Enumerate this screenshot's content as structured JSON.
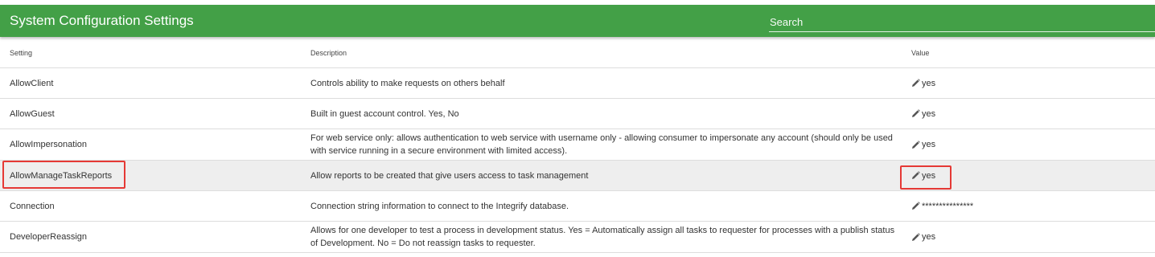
{
  "header": {
    "title": "System Configuration Settings",
    "search_placeholder": "Search"
  },
  "table": {
    "columns": {
      "setting": "Setting",
      "description": "Description",
      "value": "Value"
    },
    "rows": [
      {
        "setting": "AllowClient",
        "description": "Controls ability to make requests on others behalf",
        "value": "yes"
      },
      {
        "setting": "AllowGuest",
        "description": "Built in guest account control. Yes, No",
        "value": "yes"
      },
      {
        "setting": "AllowImpersonation",
        "description": "For web service only: allows authentication to web service with username only - allowing consumer to impersonate any account (should only be used with service running in a secure environment with limited access).",
        "value": "yes"
      },
      {
        "setting": "AllowManageTaskReports",
        "description": "Allow reports to be created that give users access to task management",
        "value": "yes",
        "highlighted": true
      },
      {
        "setting": "Connection",
        "description": "Connection string information to connect to the Integrify database.",
        "value": "***************"
      },
      {
        "setting": "DeveloperReassign",
        "description": "Allows for one developer to test a process in development status. Yes = Automatically assign all tasks to requester for processes with a publish status of Development. No = Do not reassign tasks to requester.",
        "value": "yes"
      }
    ]
  },
  "colors": {
    "header_bg": "#43a047",
    "highlight_row": "#eeeeee",
    "annotation_box": "#e53935"
  },
  "icons": {
    "edit": "pencil-icon"
  }
}
